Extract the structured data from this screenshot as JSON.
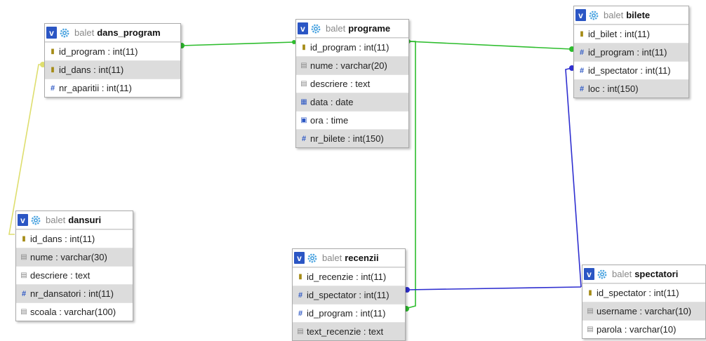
{
  "db_name": "balet",
  "colors": {
    "green": "#2dbd2d",
    "yellow": "#dede6e",
    "blue": "#2f2fd0"
  },
  "tables": {
    "dans_program": {
      "name": "dans_program",
      "fields": [
        {
          "text": "id_program : int(11)",
          "icon": "key-icon"
        },
        {
          "text": "id_dans : int(11)",
          "icon": "key-icon"
        },
        {
          "text": "nr_aparitii : int(11)",
          "icon": "hash-icon"
        }
      ]
    },
    "programe": {
      "name": "programe",
      "fields": [
        {
          "text": "id_program : int(11)",
          "icon": "key-icon"
        },
        {
          "text": "nume : varchar(20)",
          "icon": "text-icon"
        },
        {
          "text": "descriere : text",
          "icon": "text-icon"
        },
        {
          "text": "data : date",
          "icon": "calendar-icon"
        },
        {
          "text": "ora : time",
          "icon": "clock-icon"
        },
        {
          "text": "nr_bilete : int(150)",
          "icon": "hash-icon"
        }
      ]
    },
    "bilete": {
      "name": "bilete",
      "fields": [
        {
          "text": "id_bilet : int(11)",
          "icon": "key-icon"
        },
        {
          "text": "id_program : int(11)",
          "icon": "hash-icon"
        },
        {
          "text": "id_spectator : int(11)",
          "icon": "hash-icon"
        },
        {
          "text": "loc : int(150)",
          "icon": "hash-icon"
        }
      ]
    },
    "dansuri": {
      "name": "dansuri",
      "fields": [
        {
          "text": "id_dans : int(11)",
          "icon": "key-icon"
        },
        {
          "text": "nume : varchar(30)",
          "icon": "text-icon"
        },
        {
          "text": "descriere : text",
          "icon": "text-icon"
        },
        {
          "text": "nr_dansatori : int(11)",
          "icon": "hash-icon"
        },
        {
          "text": "scoala : varchar(100)",
          "icon": "text-icon"
        }
      ]
    },
    "recenzii": {
      "name": "recenzii",
      "fields": [
        {
          "text": "id_recenzie : int(11)",
          "icon": "key-icon"
        },
        {
          "text": "id_spectator : int(11)",
          "icon": "hash-icon"
        },
        {
          "text": "id_program : int(11)",
          "icon": "hash-icon"
        },
        {
          "text": "text_recenzie : text",
          "icon": "text-icon"
        }
      ]
    },
    "spectatori": {
      "name": "spectatori",
      "fields": [
        {
          "text": "id_spectator : int(11)",
          "icon": "key-icon"
        },
        {
          "text": "username : varchar(10)",
          "icon": "text-icon"
        },
        {
          "text": "parola : varchar(10)",
          "icon": "text-icon"
        }
      ]
    }
  }
}
